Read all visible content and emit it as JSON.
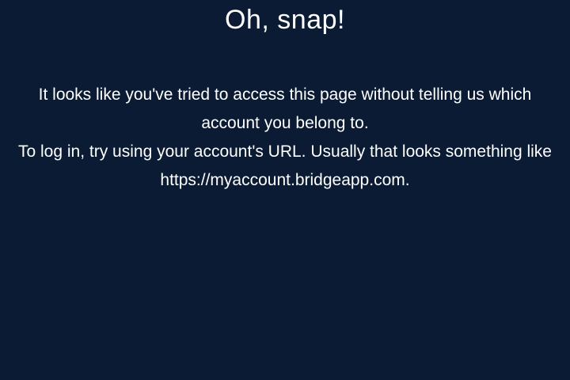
{
  "error": {
    "title": "Oh, snap!",
    "paragraph_1": "It looks like you've tried to access this page without telling us which account you belong to.",
    "paragraph_2": "To log in, try using your account's URL. Usually that looks something like https://myaccount.bridgeapp.com."
  },
  "colors": {
    "background": "#0b1b33",
    "text": "#ffffff"
  }
}
